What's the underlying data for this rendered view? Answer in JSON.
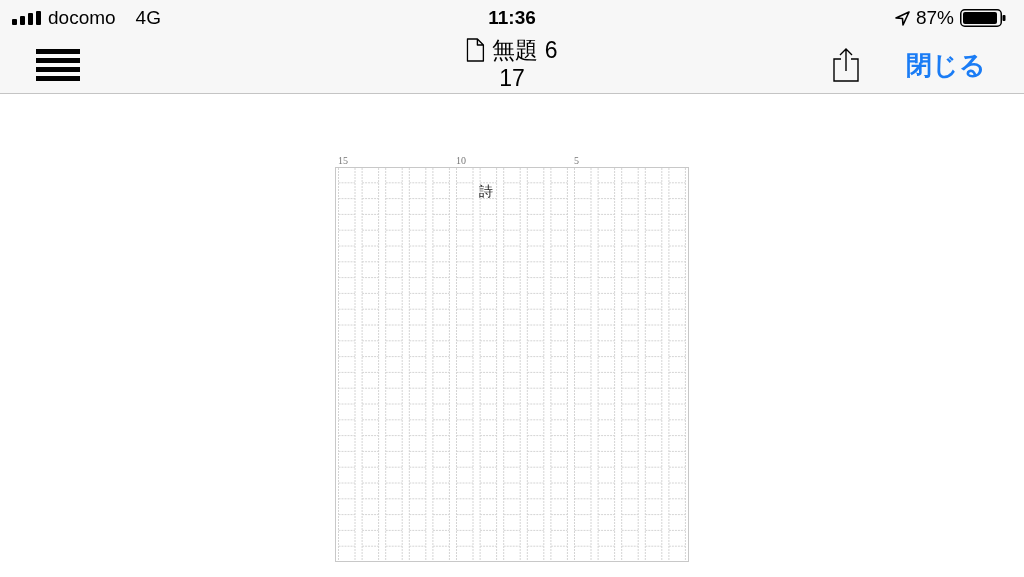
{
  "status_bar": {
    "carrier": "docomo",
    "network": "4G",
    "time": "11:36",
    "battery": "87%"
  },
  "nav_bar": {
    "title": "無題 6",
    "subtitle": "17",
    "close_button": "閉じる"
  },
  "manuscript": {
    "column_markers": [
      "15",
      "10",
      "5"
    ],
    "text": "詩"
  }
}
